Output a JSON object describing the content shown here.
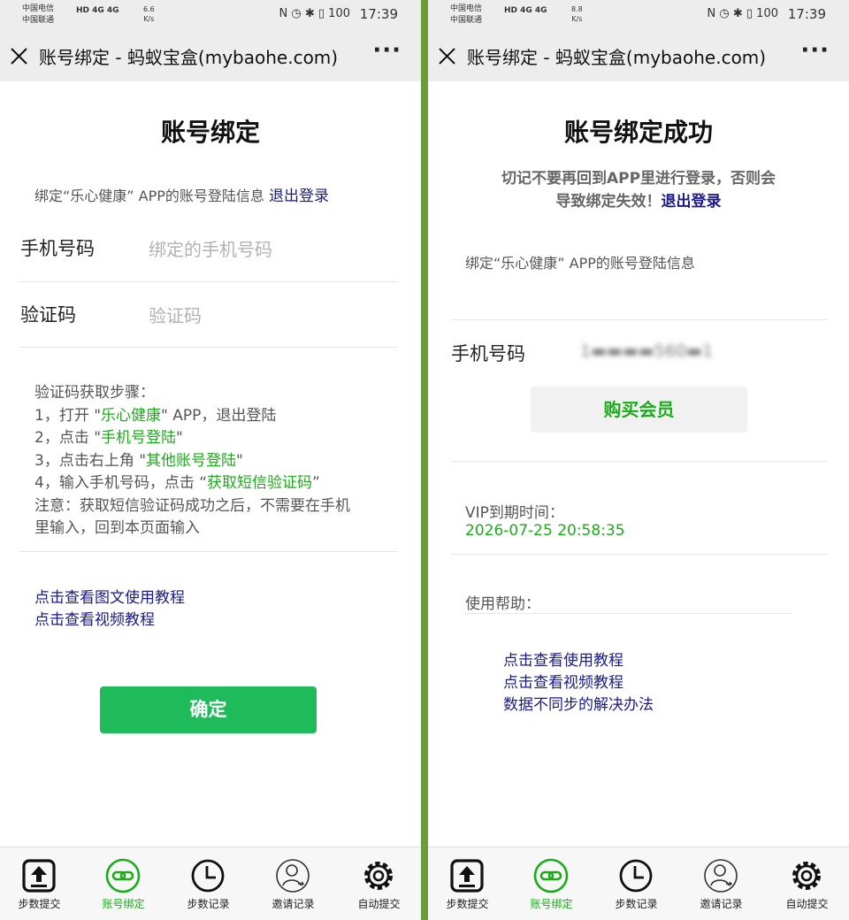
{
  "status_bar": {
    "left": {
      "carrier1": "中国电信",
      "carrier2": "中国联通",
      "signal": "HD 4G 4G",
      "speed": "6.6",
      "speed_unit": "K/s",
      "icons": "N ◷ ✱ ▯ 100",
      "time": "17:39"
    },
    "right": {
      "carrier1": "中国电信",
      "carrier2": "中国联通",
      "signal": "HD 4G 4G",
      "speed": "8.8",
      "speed_unit": "K/s",
      "icons": "N ◷ ✱ ▯ 100",
      "time": "17:39"
    }
  },
  "nav": {
    "title": "账号绑定 - 蚂蚁宝盒(mybaohe.com)",
    "more": "···"
  },
  "left": {
    "title": "账号绑定",
    "bind_info": "绑定“乐心健康” APP的账号登陆信息",
    "logout": "退出登录",
    "phone_label": "手机号码",
    "phone_placeholder": "绑定的手机号码",
    "code_label": "验证码",
    "code_placeholder": "验证码",
    "steps": {
      "title": "验证码获取步骤：",
      "s1_a": "1，打开 \"",
      "s1_b": "乐心健康",
      "s1_c": "\" APP，退出登陆",
      "s2_a": "2，点击 \"",
      "s2_b": "手机号登陆",
      "s2_c": "\"",
      "s3_a": "3，点击右上角 \"",
      "s3_b": "其他账号登陆",
      "s3_c": "\"",
      "s4_a": "4，输入手机号码，点击 “",
      "s4_b": "获取短信验证码",
      "s4_c": "”",
      "note1": "注意：获取短信验证码成功之后，不需要在手机",
      "note2": "里输入，回到本页面输入"
    },
    "tutorial_text": "点击查看图文使用教程",
    "tutorial_video": "点击查看视频教程",
    "confirm": "确定"
  },
  "right": {
    "title": "账号绑定成功",
    "warn1": "切记不要再回到APP里进行登录，否则会",
    "warn2": "导致绑定失效！",
    "logout": "退出登录",
    "bind_info": "绑定“乐心健康” APP的账号登陆信息",
    "phone_label": "手机号码",
    "phone_value": "1▬▬▬▬560▬1",
    "buy": "购买会员",
    "vip_label": "VIP到期时间：",
    "vip_value": "2026-07-25 20:58:35",
    "help_label": "使用帮助：",
    "help_links": [
      "点击查看使用教程",
      "点击查看视频教程",
      "数据不同步的解决办法"
    ]
  },
  "tabs": [
    "步数提交",
    "账号绑定",
    "步数记录",
    "邀请记录",
    "自动提交"
  ],
  "colors": {
    "green": "#1aad19",
    "button_green": "#1fba5a",
    "link": "#1a1a8a",
    "divider": "#6b9b3a"
  }
}
